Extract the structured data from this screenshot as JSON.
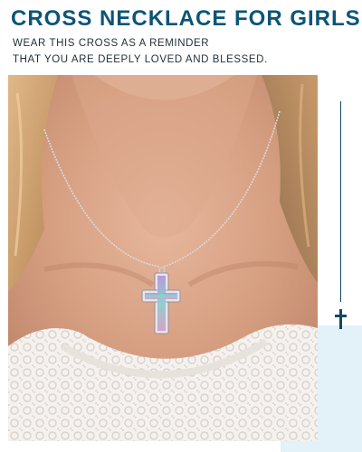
{
  "header": {
    "title": "CROSS NECKLACE FOR GIRLS",
    "subtitle_line1": "WEAR THIS CROSS AS A REMINDER",
    "subtitle_line2": "THAT YOU ARE DEEPLY LOVED AND BLESSED."
  },
  "colors": {
    "title": "#0b5576",
    "accent": "#0e4a63",
    "corner_tint": "#e3f1f8"
  },
  "icons": {
    "side_cross": "cross-icon",
    "pendant": "cross-pendant"
  }
}
